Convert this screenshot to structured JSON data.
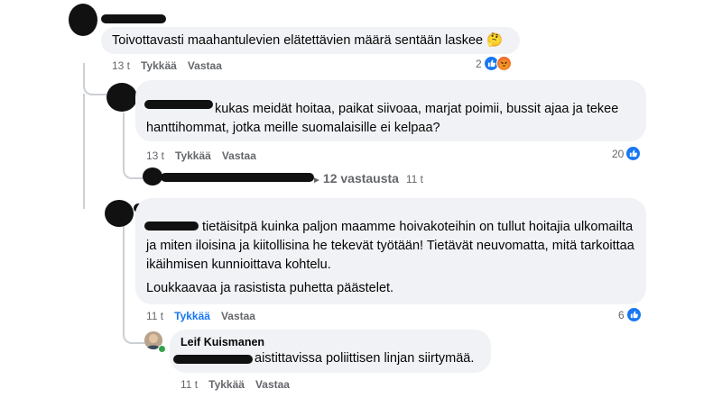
{
  "comments": [
    {
      "text": "Toivottavasti maahantulevien elätettävien määrä sentään laskee 🤔",
      "time": "13 t",
      "like_label": "Tykkää",
      "reply_label": "Vastaa",
      "reaction_count": "2",
      "reactions": [
        "like-icon",
        "angry-icon"
      ]
    },
    {
      "text": "kukas meidät hoitaa, paikat siivoaa, marjat poimii, bussit ajaa ja tekee hanttihommat, jotka meille suomalaisille ei kelpaa?",
      "time": "13 t",
      "like_label": "Tykkää",
      "reply_label": "Vastaa",
      "reaction_count": "20",
      "reactions": [
        "like-icon"
      ]
    },
    {
      "replies_text": "12 vastausta",
      "replies_time": "11 t"
    },
    {
      "text": "tietäisitpä kuinka paljon maamme hoivakoteihin on tullut hoitajia ulkomailta ja miten iloisina ja kiitollisina he tekevät työtään! Tietävät neuvomatta, mitä tarkoittaa ikäihmisen kunnioittava kohtelu.",
      "text2": "Loukkaavaa ja rasistista puhetta päästelet.",
      "time": "11 t",
      "like_label": "Tykkää",
      "reply_label": "Vastaa",
      "reaction_count": "6",
      "reactions": [
        "like-icon"
      ]
    },
    {
      "author": "Leif Kuismanen",
      "text": "aistittavissa poliittisen linjan siirtymää.",
      "time": "11 t",
      "like_label": "Tykkää",
      "reply_label": "Vastaa"
    }
  ],
  "colors": {
    "accent": "#1877f2",
    "bubble": "#f0f2f5",
    "meta": "#65676b"
  }
}
